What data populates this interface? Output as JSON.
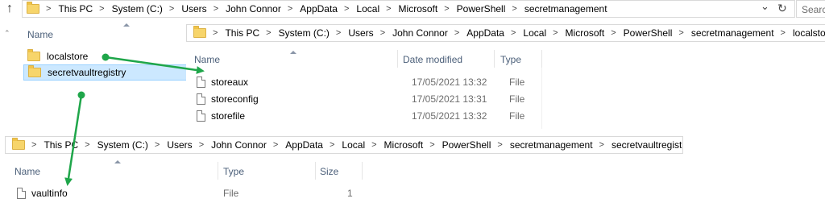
{
  "main": {
    "back_glyph": "↑",
    "address": [
      "This PC",
      "System (C:)",
      "Users",
      "John Connor",
      "AppData",
      "Local",
      "Microsoft",
      "PowerShell",
      "secretmanagement"
    ],
    "dropdown_glyph": "⌄",
    "refresh_glyph": "↻",
    "search_placeholder": "Searc",
    "column_name": "Name",
    "items": [
      "localstore",
      "secretvaultregistry"
    ]
  },
  "localstore_window": {
    "address": [
      "This PC",
      "System (C:)",
      "Users",
      "John Connor",
      "AppData",
      "Local",
      "Microsoft",
      "PowerShell",
      "secretmanagement",
      "localstore"
    ],
    "columns": {
      "name": "Name",
      "date": "Date modified",
      "type": "Type"
    },
    "files": [
      {
        "name": "storeaux",
        "date": "17/05/2021 13:32",
        "type": "File"
      },
      {
        "name": "storeconfig",
        "date": "17/05/2021 13:31",
        "type": "File"
      },
      {
        "name": "storefile",
        "date": "17/05/2021 13:32",
        "type": "File"
      }
    ]
  },
  "registry_window": {
    "address": [
      "This PC",
      "System (C:)",
      "Users",
      "John Connor",
      "AppData",
      "Local",
      "Microsoft",
      "PowerShell",
      "secretmanagement",
      "secretvaultregistry"
    ],
    "columns": {
      "name": "Name",
      "type": "Type",
      "size": "Size"
    },
    "files": [
      {
        "name": "vaultinfo",
        "type": "File",
        "size": "1"
      }
    ]
  },
  "colors": {
    "arrow": "#1fa64a",
    "selection": "#cce8ff",
    "selection_border": "#99d1ff"
  }
}
